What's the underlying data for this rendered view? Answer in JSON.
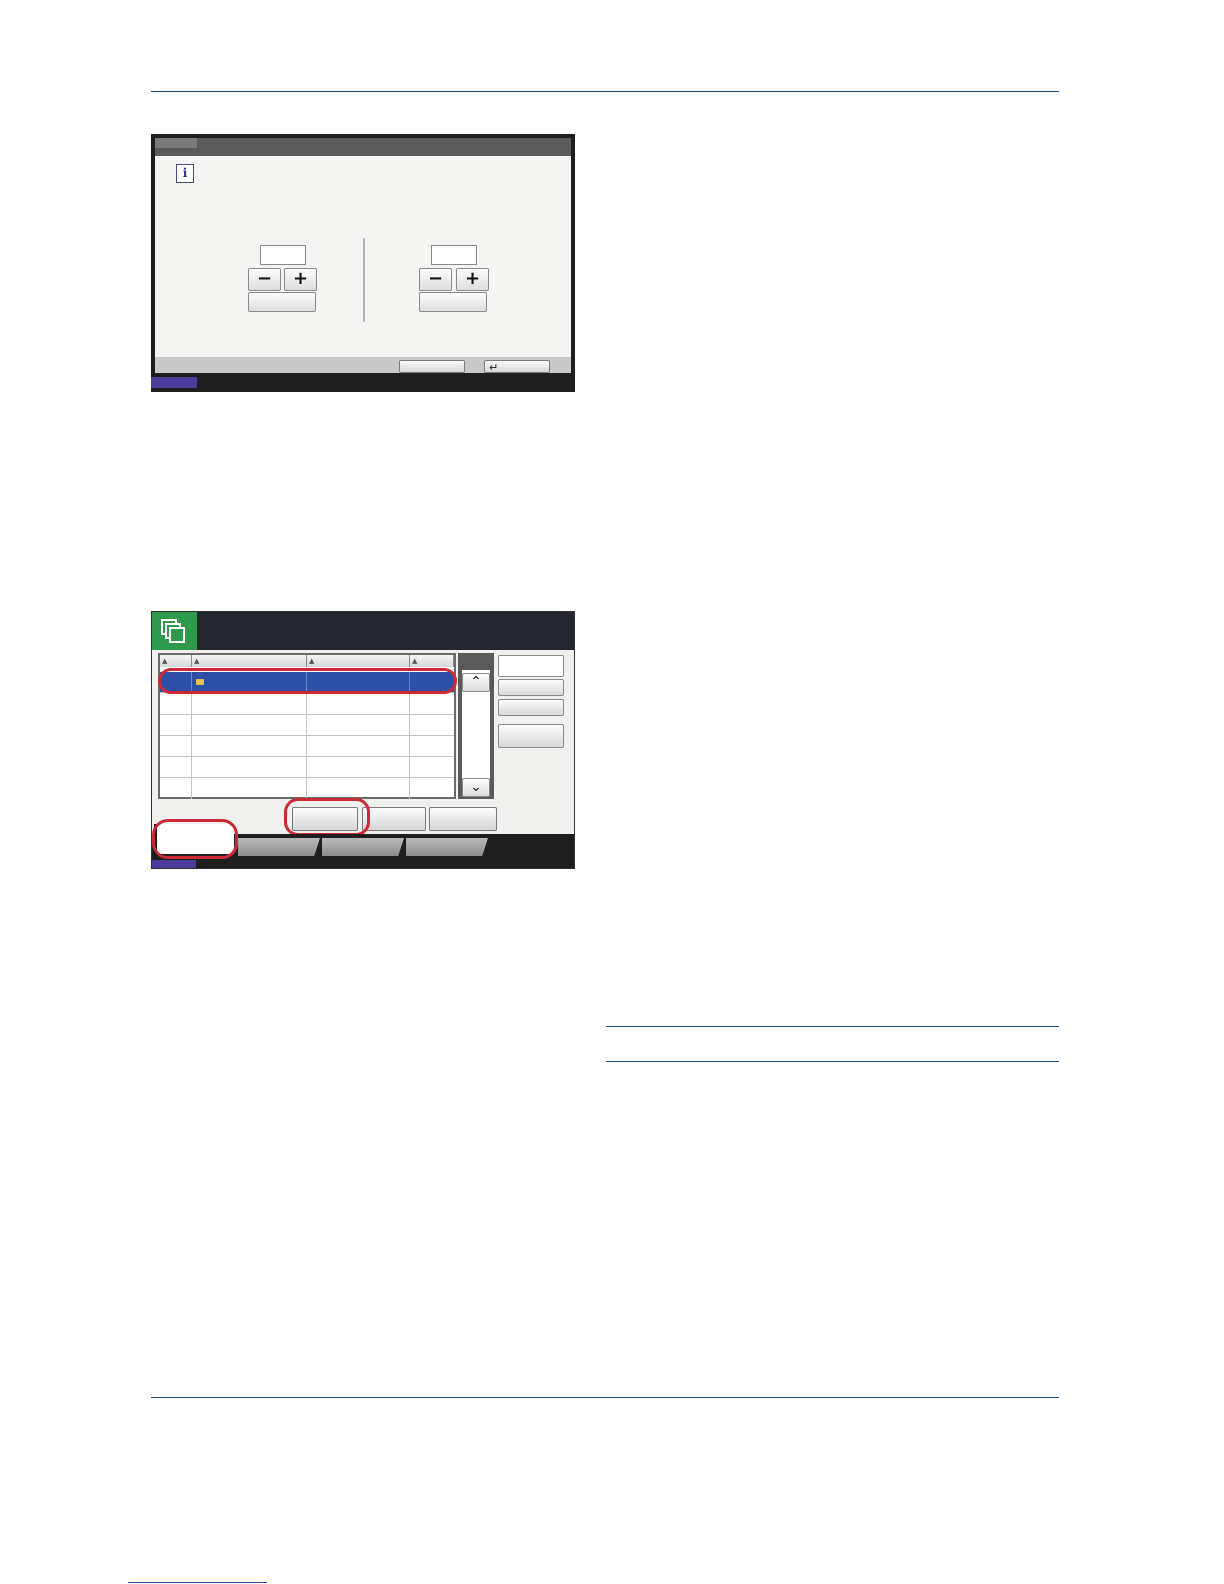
{
  "page": {
    "footer_link": ""
  },
  "screen1": {
    "info_icon": "info-icon",
    "left_stepper": {
      "minus": "−",
      "plus": "+"
    },
    "right_stepper": {
      "minus": "−",
      "plus": "+"
    },
    "ok_button_icon": "↵",
    "accent_color": "#4b3b9a"
  },
  "screen2": {
    "header_icon": "document-box-icon",
    "header_color": "#2f9a4c",
    "column_sort_marks": [
      "▲",
      "▲",
      "▲",
      "▲"
    ],
    "selected_row_color": "#2e4fa6",
    "scroll_up": "⌃",
    "scroll_down": "⌄",
    "highlight_color": "#cc2a36"
  }
}
